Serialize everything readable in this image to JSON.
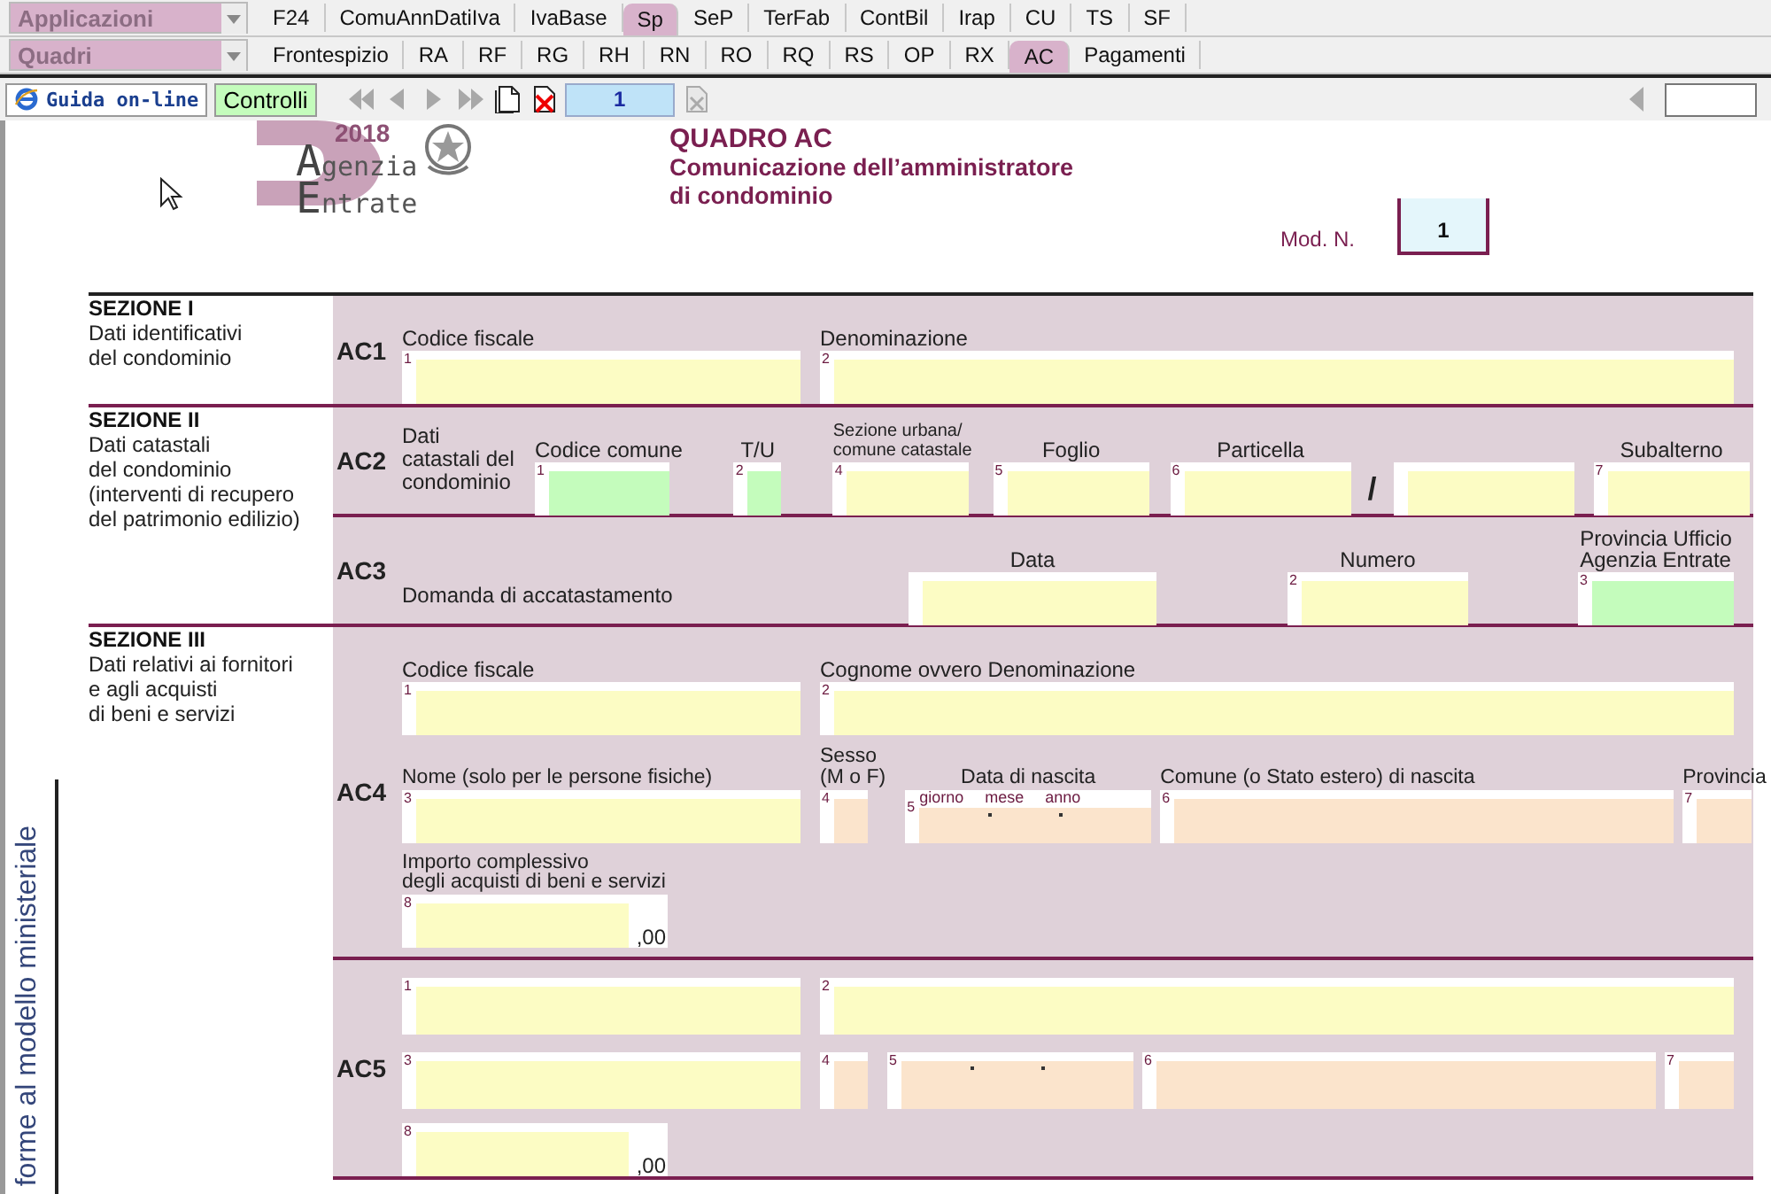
{
  "menus": [
    {
      "label": "Applicazioni",
      "tabs": [
        {
          "label": "F24",
          "selected": false
        },
        {
          "label": "ComuAnnDatiIva",
          "selected": false
        },
        {
          "label": "IvaBase",
          "selected": false
        },
        {
          "label": "Sp",
          "selected": true
        },
        {
          "label": "SeP",
          "selected": false
        },
        {
          "label": "TerFab",
          "selected": false
        },
        {
          "label": "ContBil",
          "selected": false
        },
        {
          "label": "Irap",
          "selected": false
        },
        {
          "label": "CU",
          "selected": false
        },
        {
          "label": "TS",
          "selected": false
        },
        {
          "label": "SF",
          "selected": false
        }
      ]
    },
    {
      "label": "Quadri",
      "tabs": [
        {
          "label": "Frontespizio",
          "selected": false
        },
        {
          "label": "RA",
          "selected": false
        },
        {
          "label": "RF",
          "selected": false
        },
        {
          "label": "RG",
          "selected": false
        },
        {
          "label": "RH",
          "selected": false
        },
        {
          "label": "RN",
          "selected": false
        },
        {
          "label": "RO",
          "selected": false
        },
        {
          "label": "RQ",
          "selected": false
        },
        {
          "label": "RS",
          "selected": false
        },
        {
          "label": "OP",
          "selected": false
        },
        {
          "label": "RX",
          "selected": false
        },
        {
          "label": "AC",
          "selected": true
        },
        {
          "label": "Pagamenti",
          "selected": false
        }
      ]
    }
  ],
  "toolbar": {
    "help_button": "Guida on-line",
    "check_button": "Controlli",
    "nav_disabled": true,
    "page_field": "1"
  },
  "header": {
    "logo_year": "2018",
    "logo_line1": "Agenzia",
    "logo_line2": "Entrate",
    "title": "QUADRO AC",
    "subtitle": "Comunicazione dell’amministratore\ndi condominio",
    "mod_label": "Mod. N.",
    "mod_value": "1"
  },
  "side_text": "forme al modello ministeriale",
  "sections": [
    {
      "title": "SEZIONE I",
      "description": "Dati identificativi\ndel condominio",
      "rows": [
        {
          "code": "AC1",
          "lines": [
            [
              {
                "kind": "field",
                "number": "1",
                "label": "Codice fiscale",
                "color": "#fcfcc4"
              },
              {
                "kind": "field",
                "number": "2",
                "label": "Denominazione",
                "color": "#fcfcc4"
              }
            ]
          ]
        }
      ]
    },
    {
      "title": "SEZIONE II",
      "description": "Dati catastali\ndel condominio\n(interventi di recupero\ndel patrimonio edilizio)",
      "rows": [
        {
          "code": "AC2",
          "lines": [
            [
              {
                "kind": "text",
                "text": "Dati\ncatastali del\ncondominio"
              },
              {
                "kind": "field",
                "number": "1",
                "label": "Codice comune",
                "color": "#c4fcbc"
              },
              {
                "kind": "field",
                "number": "2",
                "label": "T/U",
                "color": "#c4fcbc"
              },
              {
                "kind": "field",
                "number": "4",
                "label": "Sezione urbana/\ncomune catastale",
                "color": "#fcfcc4"
              },
              {
                "kind": "field",
                "number": "5",
                "label": "Foglio",
                "color": "#fcfcc4"
              },
              {
                "kind": "field",
                "number": "6",
                "label": "Particella",
                "color": "#fcfcc4"
              },
              {
                "kind": "sep",
                "text": "/"
              },
              {
                "kind": "field",
                "color": "#fcfcc4"
              },
              {
                "kind": "field",
                "number": "7",
                "label": "Subalterno",
                "color": "#fcfcc4"
              }
            ]
          ]
        },
        {
          "code": "AC3",
          "lines": [
            [
              {
                "kind": "text",
                "text": "Domanda di accatastamento"
              },
              {
                "kind": "field",
                "label": "Data",
                "color": "#fcfcc4"
              },
              {
                "kind": "field",
                "number": "2",
                "label": "Numero",
                "color": "#fcfcc4"
              },
              {
                "kind": "field",
                "number": "3",
                "label": "Provincia Ufficio\nAgenzia Entrate",
                "color": "#c4fcbc"
              }
            ]
          ]
        }
      ]
    },
    {
      "title": "SEZIONE III",
      "description": "Dati relativi ai fornitori\ne agli acquisti\ndi beni e servizi",
      "rows": [
        {
          "code": "AC4",
          "lines": [
            [
              {
                "kind": "field",
                "number": "1",
                "label": "Codice fiscale",
                "color": "#fcfcc4"
              },
              {
                "kind": "field",
                "number": "2",
                "label": "Cognome ovvero Denominazione",
                "color": "#fcfcc4"
              }
            ],
            [
              {
                "kind": "field",
                "number": "3",
                "label": "Nome (solo per le persone fisiche)",
                "color": "#fcfcc4"
              },
              {
                "kind": "field",
                "number": "4",
                "label": "Sesso\n(M o F)",
                "color": "#fbe4cc"
              },
              {
                "kind": "date",
                "number": "5",
                "label": "Data di nascita",
                "sublabels": [
                  "giorno",
                  "mese",
                  "anno"
                ],
                "color": "#fbe4cc"
              },
              {
                "kind": "field",
                "number": "6",
                "label": "Comune (o Stato estero) di nascita",
                "color": "#fbe4cc"
              },
              {
                "kind": "field",
                "number": "7",
                "label": "Provincia",
                "color": "#fbe4cc"
              }
            ],
            [
              {
                "kind": "field",
                "number": "8",
                "label": "Importo complessivo\ndegli acquisti di beni e servizi",
                "suffix": ",00",
                "color": "#fcfcc4"
              }
            ]
          ]
        },
        {
          "code": "AC5",
          "lines": [
            [
              {
                "kind": "field",
                "number": "1",
                "color": "#fcfcc4"
              },
              {
                "kind": "field",
                "number": "2",
                "color": "#fcfcc4"
              }
            ],
            [
              {
                "kind": "field",
                "number": "3",
                "color": "#fcfcc4"
              },
              {
                "kind": "field",
                "number": "4",
                "color": "#fbe4cc"
              },
              {
                "kind": "date",
                "number": "5",
                "color": "#fbe4cc"
              },
              {
                "kind": "field",
                "number": "6",
                "color": "#fbe4cc"
              },
              {
                "kind": "field",
                "number": "7",
                "color": "#fbe4cc"
              }
            ],
            [
              {
                "kind": "field",
                "number": "8",
                "suffix": ",00",
                "color": "#fcfcc4"
              }
            ]
          ]
        }
      ]
    }
  ]
}
